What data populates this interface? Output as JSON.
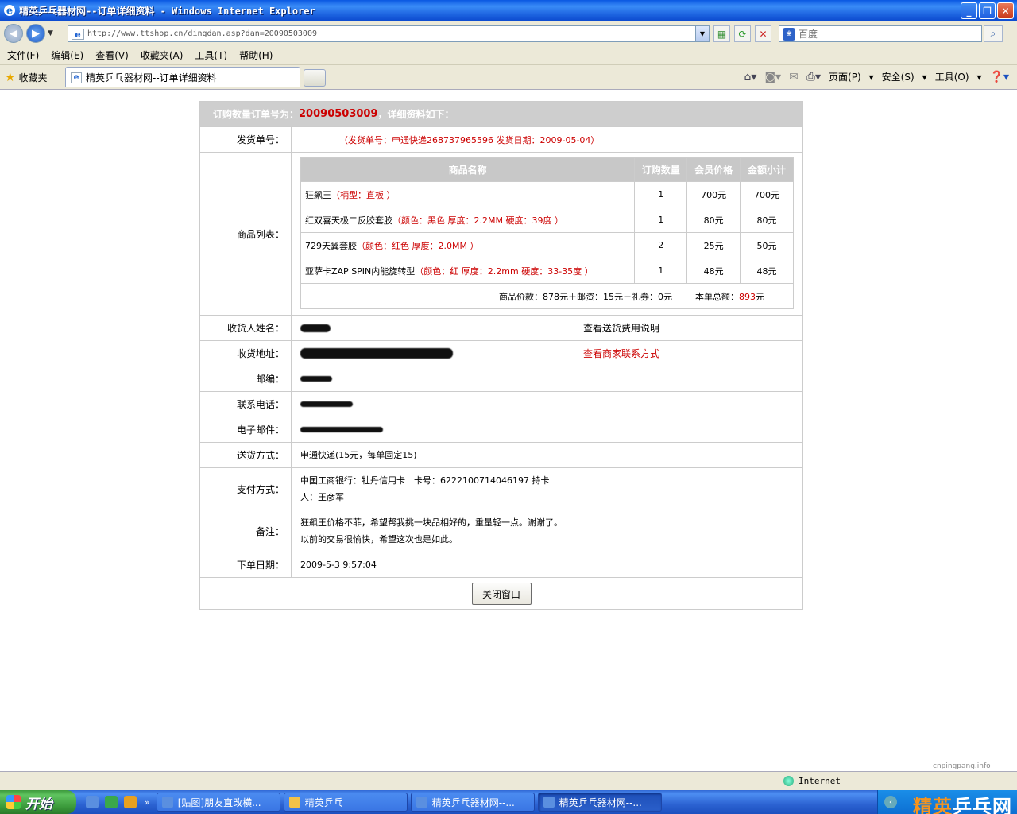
{
  "window": {
    "title": "精英乒乓器材网--订单详细资料 - Windows Internet Explorer"
  },
  "address": {
    "url": "http://www.ttshop.cn/dingdan.asp?dan=20090503009"
  },
  "search": {
    "placeholder": "百度"
  },
  "menu": {
    "items": [
      "文件(F)",
      "编辑(E)",
      "查看(V)",
      "收藏夹(A)",
      "工具(T)",
      "帮助(H)"
    ]
  },
  "favorites": {
    "label": "收藏夹"
  },
  "tab": {
    "title": "精英乒乓器材网--订单详细资料"
  },
  "commandbar": {
    "page": "页面(P)",
    "safety": "安全(S)",
    "tools": "工具(O)"
  },
  "order": {
    "header_prefix": "订购数量订单号为：",
    "number": "20090503009",
    "header_suffix": "，详细资料如下：",
    "shipping_label": "发货单号：",
    "shipping_value": "（发货单号：申通快递268737965596 发货日期：2009-05-04）",
    "goods_label": "商品列表：",
    "goods_headers": [
      "商品名称",
      "订购数量",
      "会员价格",
      "金额小计"
    ],
    "goods": [
      {
        "name": "狂飙王",
        "attrs": "（柄型：直板 ）",
        "qty": "1",
        "price": "700元",
        "subtotal": "700元"
      },
      {
        "name": "红双喜天极二反胶套胶",
        "attrs": "（颜色：黑色 厚度：2.2MM 硬度：39度 ）",
        "qty": "1",
        "price": "80元",
        "subtotal": "80元"
      },
      {
        "name": "729天翼套胶",
        "attrs": "（颜色：红色 厚度：2.0MM ）",
        "qty": "2",
        "price": "25元",
        "subtotal": "50元"
      },
      {
        "name": "亚萨卡ZAP SPIN内能旋转型",
        "attrs": "（颜色：红 厚度：2.2mm 硬度：33-35度 ）",
        "qty": "1",
        "price": "48元",
        "subtotal": "48元"
      }
    ],
    "total_text": "商品价款：878元＋邮资：15元－礼券：0元",
    "grand_label": "本单总额：",
    "grand_value": "893",
    "grand_unit": "元",
    "name_label": "收货人姓名：",
    "name_side": "查看送货费用说明",
    "address_label": "收货地址：",
    "address_side": "查看商家联系方式",
    "zip_label": "邮编：",
    "phone_label": "联系电话：",
    "email_label": "电子邮件：",
    "delivery_label": "送货方式：",
    "delivery_value": "申通快递(15元，每单固定15)",
    "payment_label": "支付方式：",
    "payment_value": "中国工商银行：牡丹信用卡　卡号：6222100714046197 持卡人：王彦军",
    "note_label": "备注：",
    "note_value": "狂飙王价格不菲，希望帮我挑一块品相好的，重量轻一点。谢谢了。以前的交易很愉快，希望这次也是如此。",
    "date_label": "下单日期：",
    "date_value": "2009-5-3 9:57:04",
    "close_button": "关闭窗口"
  },
  "status": {
    "zone": "Internet",
    "watermark": "cnpingpang.info"
  },
  "taskbar": {
    "start": "开始",
    "items": [
      "[贴图]朋友直改横...",
      "精英乒乓",
      "精英乒乓器材网--...",
      "精英乒乓器材网--..."
    ],
    "brand_a": "精英",
    "brand_b": "乒乓网"
  }
}
